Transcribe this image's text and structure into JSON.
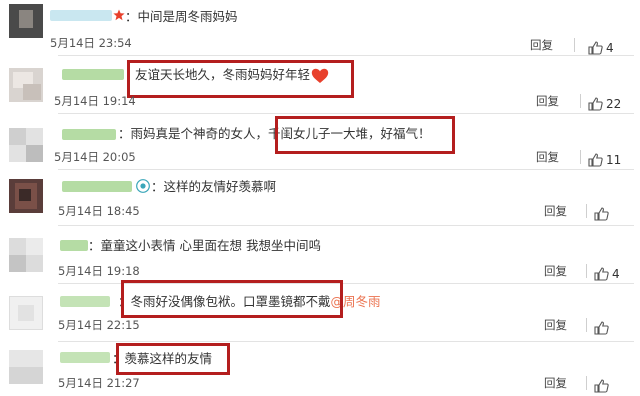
{
  "colors": {
    "highlight_box": "#b41e1e",
    "mention": "#eb7350",
    "heart": "#e8402c",
    "username_blur": "#b5dca4"
  },
  "icons": {
    "like": "thumbs-up-icon",
    "heart": "heart-icon",
    "user_badge": "camera-badge-icon",
    "vip_star": "star-icon"
  },
  "comments": [
    {
      "text": "：中间是周冬雨妈妈",
      "mention": "",
      "text_after": "",
      "time": "5月14日 23:54",
      "reply_label": "回复",
      "likes": "4"
    },
    {
      "text": "友谊天长地久，冬雨妈妈好年轻",
      "mention": "",
      "text_after": "",
      "time": "5月14日 19:14",
      "reply_label": "回复",
      "likes": "22"
    },
    {
      "text": "：雨妈真是个神奇的女人，千闺女儿子一大堆，好福气！",
      "mention": "",
      "text_after": "",
      "time": "5月14日 20:05",
      "reply_label": "回复",
      "likes": "11"
    },
    {
      "text": "：这样的友情好羡慕啊",
      "mention": "",
      "text_after": "",
      "time": "5月14日 18:45",
      "reply_label": "回复",
      "likes": ""
    },
    {
      "text": "：童童这小表情 心里面在想 我想坐中间呜",
      "mention": "",
      "text_after": "",
      "time": "5月14日 19:18",
      "reply_label": "回复",
      "likes": "4"
    },
    {
      "text": "：冬雨好没偶像包袱。口罩墨镜都不戴",
      "mention": "@周冬雨",
      "text_after": "",
      "time": "5月14日 22:15",
      "reply_label": "回复",
      "likes": ""
    },
    {
      "text": "：羡慕这样的友情",
      "mention": "",
      "text_after": "",
      "time": "5月14日 21:27",
      "reply_label": "回复",
      "likes": ""
    }
  ]
}
